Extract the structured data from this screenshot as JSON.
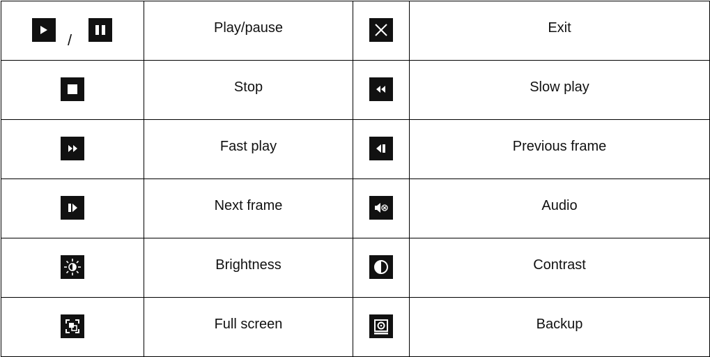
{
  "rows": [
    {
      "left": {
        "icon": "play-pause-icon",
        "label": "Play/pause",
        "separator": "/"
      },
      "right": {
        "icon": "close-icon",
        "label": "Exit"
      }
    },
    {
      "left": {
        "icon": "stop-icon",
        "label": "Stop"
      },
      "right": {
        "icon": "rewind-icon",
        "label": "Slow play"
      }
    },
    {
      "left": {
        "icon": "fast-forward-icon",
        "label": "Fast play"
      },
      "right": {
        "icon": "previous-frame-icon",
        "label": "Previous frame"
      }
    },
    {
      "left": {
        "icon": "next-frame-icon",
        "label": "Next frame"
      },
      "right": {
        "icon": "audio-muted-icon",
        "label": "Audio"
      }
    },
    {
      "left": {
        "icon": "brightness-icon",
        "label": "Brightness"
      },
      "right": {
        "icon": "contrast-icon",
        "label": "Contrast"
      }
    },
    {
      "left": {
        "icon": "full-screen-icon",
        "label": "Full screen"
      },
      "right": {
        "icon": "backup-icon",
        "label": "Backup"
      }
    }
  ],
  "colors": {
    "icon_background": "#111111",
    "icon_foreground": "#ffffff",
    "border": "#000000",
    "text": "#111111"
  }
}
